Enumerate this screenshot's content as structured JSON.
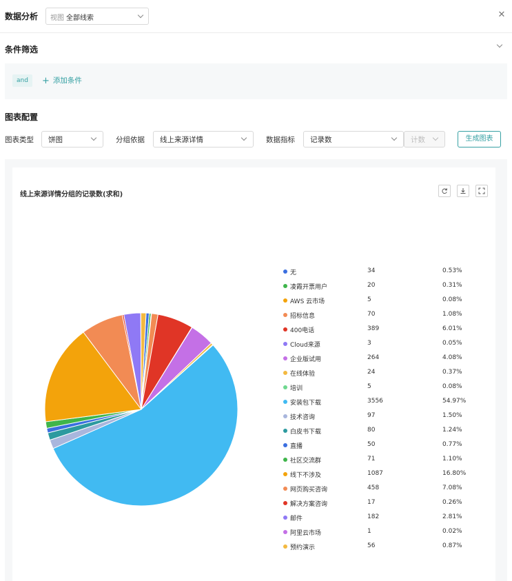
{
  "header": {
    "title": "数据分析",
    "view_prefix": "视图",
    "view_value": "全部线索"
  },
  "filter": {
    "title": "条件筛选",
    "and_tag": "and",
    "add_condition": "添加条件"
  },
  "config": {
    "title": "图表配置",
    "chart_type_label": "图表类型",
    "chart_type_value": "饼图",
    "group_label": "分组依据",
    "group_value": "线上来源详情",
    "metric_label": "数据指标",
    "metric_value": "记录数",
    "agg_placeholder": "计数",
    "generate_button": "生成图表"
  },
  "chart_data": {
    "type": "pie",
    "title": "线上来源详情分组的记录数(求和)",
    "legend_position": "right",
    "slices": [
      {
        "name": "无",
        "value": 34,
        "percent": "0.53%",
        "color": "#3b6fe0"
      },
      {
        "name": "凌霞开票用户",
        "value": 20,
        "percent": "0.31%",
        "color": "#3fb54b"
      },
      {
        "name": "AWS 云市场",
        "value": 5,
        "percent": "0.08%",
        "color": "#f3a30b"
      },
      {
        "name": "招标信息",
        "value": 70,
        "percent": "1.08%",
        "color": "#f28b54"
      },
      {
        "name": "400电话",
        "value": 389,
        "percent": "6.01%",
        "color": "#e03526"
      },
      {
        "name": "Cloud来源",
        "value": 3,
        "percent": "0.05%",
        "color": "#8f79f5"
      },
      {
        "name": "企业版试用",
        "value": 264,
        "percent": "4.08%",
        "color": "#c470e6"
      },
      {
        "name": "在线体验",
        "value": 24,
        "percent": "0.37%",
        "color": "#f3b941"
      },
      {
        "name": "培训",
        "value": 5,
        "percent": "0.08%",
        "color": "#6fd88f"
      },
      {
        "name": "安装包下载",
        "value": 3556,
        "percent": "54.97%",
        "color": "#41baf2"
      },
      {
        "name": "技术咨询",
        "value": 97,
        "percent": "1.50%",
        "color": "#a9b6dd"
      },
      {
        "name": "白皮书下载",
        "value": 80,
        "percent": "1.24%",
        "color": "#2c9a9f"
      },
      {
        "name": "直播",
        "value": 50,
        "percent": "0.77%",
        "color": "#3b6fe0"
      },
      {
        "name": "社区交流群",
        "value": 71,
        "percent": "1.10%",
        "color": "#3fb54b"
      },
      {
        "name": "线下不涉及",
        "value": 1087,
        "percent": "16.80%",
        "color": "#f3a30b"
      },
      {
        "name": "网页购买咨询",
        "value": 458,
        "percent": "7.08%",
        "color": "#f28b54"
      },
      {
        "name": "解决方案咨询",
        "value": 17,
        "percent": "0.26%",
        "color": "#e03526"
      },
      {
        "name": "邮件",
        "value": 182,
        "percent": "2.81%",
        "color": "#8f79f5"
      },
      {
        "name": "阿里云市场",
        "value": 1,
        "percent": "0.02%",
        "color": "#c470e6"
      },
      {
        "name": "预约演示",
        "value": 56,
        "percent": "0.87%",
        "color": "#f3b941"
      }
    ]
  },
  "icons": {
    "refresh": "refresh-icon",
    "download": "download-icon",
    "fullscreen": "fullscreen-icon",
    "close": "close-icon"
  }
}
